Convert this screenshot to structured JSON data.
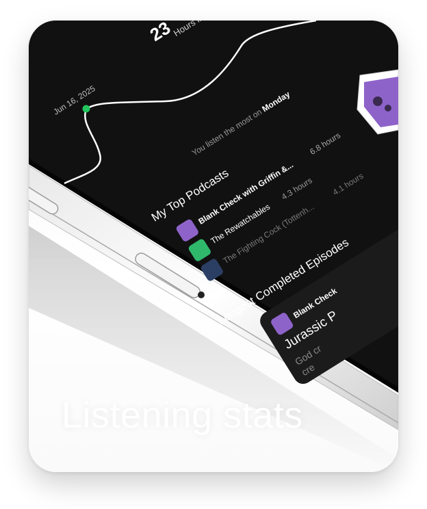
{
  "hero": {
    "hours_value": "23",
    "hours_label": "Hours listened",
    "date_label": "Jun 16, 2025",
    "most_listened_prefix": "You listen the most on",
    "most_listened_day": "Monday"
  },
  "top_podcasts": {
    "title": "My Top Podcasts",
    "items": [
      {
        "name": "Blank Check with Griffin &...",
        "hours": "6.8 hours",
        "color": "#8e63c9"
      },
      {
        "name": "The Rewatchables",
        "hours": "4.3 hours",
        "color": "#2fb86c"
      },
      {
        "name": "The Fighting Cock (Tottenh...",
        "hours": "4.1 hours",
        "color": "#2b3e63"
      }
    ]
  },
  "longest": {
    "title": "Longest Completed Episodes",
    "podcast": "Blank Check",
    "episode": "Jurassic P",
    "desc1": "God cr",
    "desc2": "cre"
  },
  "caption": "Listening stats",
  "colors": {
    "screen": "#111111",
    "accent_green": "#22c55e",
    "card_bg": "#1c1b1c"
  }
}
